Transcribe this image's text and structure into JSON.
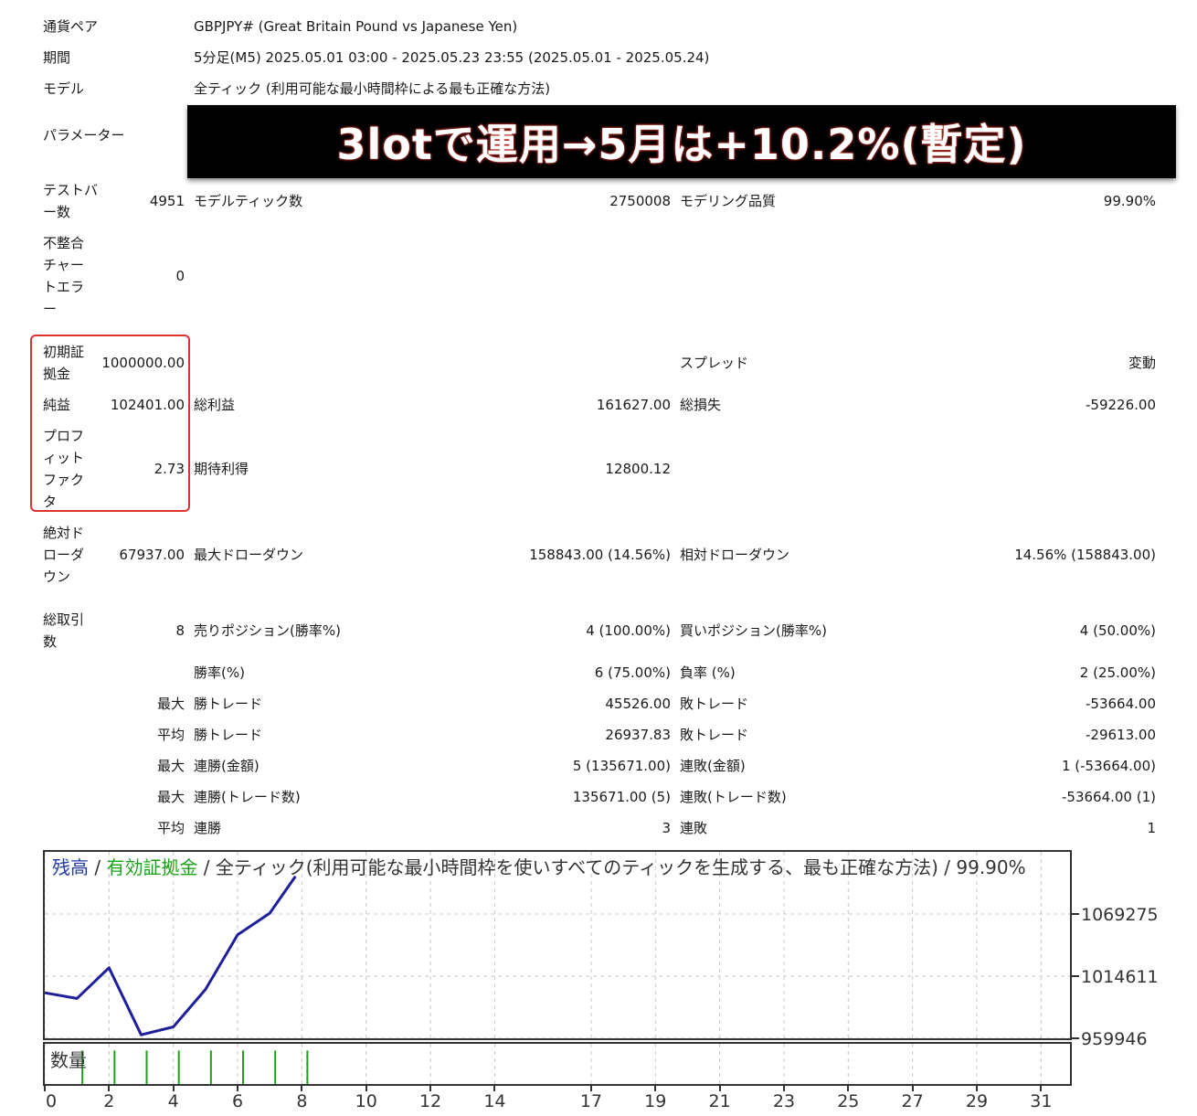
{
  "report": {
    "symbol_label": "通貨ペア",
    "symbol_value": "GBPJPY# (Great Britain Pound vs Japanese Yen)",
    "period_label": "期間",
    "period_value": "5分足(M5) 2025.05.01 03:00 - 2025.05.23 23:55 (2025.05.01 - 2025.05.24)",
    "model_label": "モデル",
    "model_value": "全ティック (利用可能な最小時間枠による最も正確な方法)",
    "params_label": "パラメーター",
    "banner_text": "3lotで運用→5月は+10.2%(暫定)",
    "bars_label": "テストバー数",
    "bars_value": "4951",
    "ticks_label": "モデルティック数",
    "ticks_value": "2750008",
    "quality_label": "モデリング品質",
    "quality_value": "99.90%",
    "mismatch_label": "不整合チャートエラー",
    "mismatch_value": "0",
    "deposit_label": "初期証拠金",
    "deposit_value": "1000000.00",
    "spread_label": "スプレッド",
    "spread_value": "変動",
    "net_label": "純益",
    "net_value": "102401.00",
    "gross_profit_label": "総利益",
    "gross_profit_value": "161627.00",
    "gross_loss_label": "総損失",
    "gross_loss_value": "-59226.00",
    "pf_label": "プロフィットファクタ",
    "pf_value": "2.73",
    "expected_label": "期待利得",
    "expected_value": "12800.12",
    "abs_dd_label": "絶対ドローダウン",
    "abs_dd_value": "67937.00",
    "max_dd_label": "最大ドローダウン",
    "max_dd_value": "158843.00 (14.56%)",
    "rel_dd_label": "相対ドローダウン",
    "rel_dd_value": "14.56% (158843.00)",
    "trades_label": "総取引数",
    "trades_value": "8",
    "short_label": "売りポジション(勝率%)",
    "short_value": "4 (100.00%)",
    "long_label": "買いポジション(勝率%)",
    "long_value": "4 (50.00%)",
    "win_label": "勝率(%)",
    "win_value": "6 (75.00%)",
    "loss_label": "負率 (%)",
    "loss_value": "2 (25.00%)",
    "max_label": "最大",
    "avg_label": "平均",
    "largest_win_label": "勝トレード",
    "largest_win_value": "45526.00",
    "largest_loss_label": "敗トレード",
    "largest_loss_value": "-53664.00",
    "avg_win_label": "勝トレード",
    "avg_win_value": "26937.83",
    "avg_loss_label": "敗トレード",
    "avg_loss_value": "-29613.00",
    "max_consec_win_label": "連勝(金額)",
    "max_consec_win_value": "5 (135671.00)",
    "max_consec_loss_label": "連敗(金額)",
    "max_consec_loss_value": "1 (-53664.00)",
    "max_consec_win_n_label": "連勝(トレード数)",
    "max_consec_win_n_value": "135671.00 (5)",
    "max_consec_loss_n_label": "連敗(トレード数)",
    "max_consec_loss_n_value": "-53664.00 (1)",
    "avg_consec_win_label": "連勝",
    "avg_consec_win_value": "3",
    "avg_consec_loss_label": "連敗",
    "avg_consec_loss_value": "1"
  },
  "chart": {
    "legend_balance": "残高",
    "legend_sep1": " / ",
    "legend_equity": "有効証拠金",
    "legend_sep2": " / ",
    "legend_rest": "全ティック(利用可能な最小時間枠を使いすべてのティックを生成する、最も正確な方法) / 99.90%",
    "volume_label": "数量",
    "colors": {
      "balance": "#1f1f99",
      "volume": "#1aa31a",
      "grid": "#c8c8c8",
      "axis": "#333333"
    }
  },
  "chart_data": {
    "type": "line",
    "title": "",
    "xlabel": "",
    "ylabel": "",
    "x": [
      0,
      1,
      2,
      3,
      4,
      5,
      6,
      7,
      7.8
    ],
    "series": [
      {
        "name": "残高",
        "values": [
          1000000,
          995000,
          1022000,
          963000,
          970000,
          1003000,
          1051000,
          1070000,
          1102401
        ]
      }
    ],
    "xticks": [
      0,
      2,
      4,
      6,
      8,
      10,
      12,
      14,
      17,
      19,
      21,
      23,
      25,
      27,
      29,
      31
    ],
    "yticks": [
      959946,
      1014611,
      1069275
    ],
    "ylim": [
      959946,
      1124000
    ],
    "xlim": [
      0,
      31.9
    ],
    "grid": true,
    "volume_x": [
      1,
      2,
      3,
      4,
      5,
      6,
      7,
      8
    ],
    "volume_values": [
      3,
      3,
      3,
      3,
      3,
      3,
      3,
      3
    ]
  }
}
